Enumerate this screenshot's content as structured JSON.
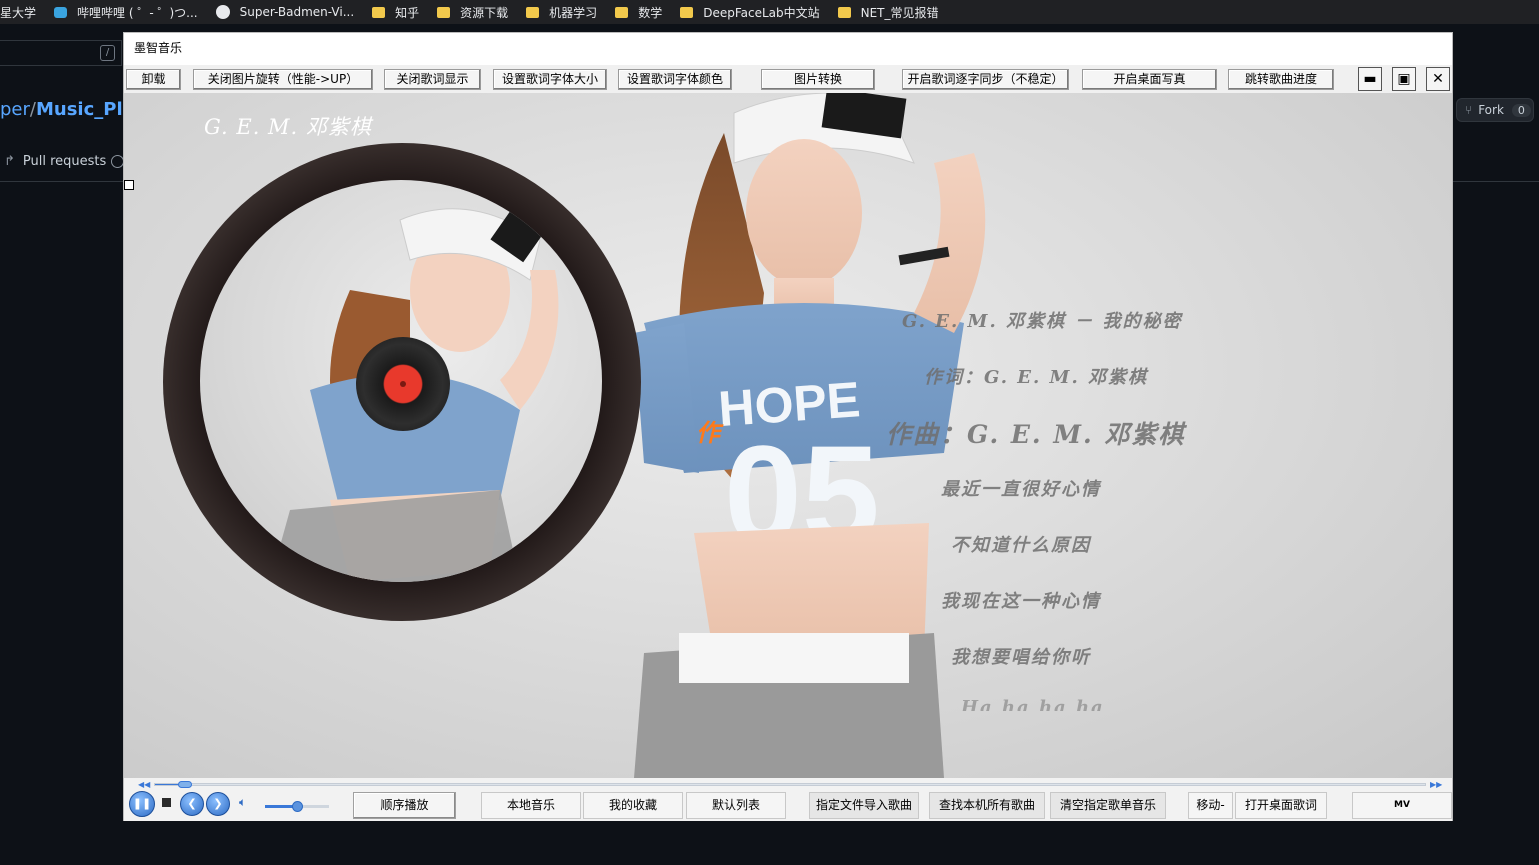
{
  "bookmarks": [
    {
      "label": "星大学",
      "icon": "none"
    },
    {
      "label": "哔哩哔哩 ( ゜- ゜)つ...",
      "icon": "bilibili-icon"
    },
    {
      "label": "Super-Badmen-Vi...",
      "icon": "github-icon"
    },
    {
      "label": "知乎",
      "icon": "folder-icon"
    },
    {
      "label": "资源下载",
      "icon": "folder-icon"
    },
    {
      "label": "机器学习",
      "icon": "folder-icon"
    },
    {
      "label": "数学",
      "icon": "folder-icon"
    },
    {
      "label": "DeepFaceLab中文站",
      "icon": "folder-icon"
    },
    {
      "label": "NET_常见报错",
      "icon": "folder-icon"
    }
  ],
  "github": {
    "search_slash": "/",
    "repo_owner": "per",
    "repo_sep": "/",
    "repo_name": "Music_Play",
    "pull_requests": "Pull requests",
    "fork_label": "Fork",
    "fork_count": "0"
  },
  "app": {
    "title": "墨智音乐",
    "toolbar": [
      "卸载",
      "关闭图片旋转（性能->UP）",
      "关闭歌词显示",
      "设置歌词字体大小",
      "设置歌词字体颜色",
      "图片转换",
      "开启歌词逐字同步（不稳定）",
      "开启桌面写真",
      "跳转歌曲进度"
    ],
    "window_buttons": {
      "minimize": "▬",
      "maximize": "▣",
      "close": "✕"
    },
    "singer": "G. E. M. 邓紫棋",
    "highlight_char": "作",
    "lyrics": [
      "G. E. M. 邓紫棋 － 我的秘密",
      "作词：G. E. M.  邓紫棋",
      "作曲：G. E. M.  邓紫棋",
      "最近一直很好心情",
      "不知道什么原因",
      "我现在这一种心情",
      "我想要唱给你听",
      "Ha ha ha ha"
    ],
    "progress_fraction": 0.02,
    "volume_fraction": 0.5,
    "controls": {
      "play_mode": "顺序播放",
      "local_music": "本地音乐",
      "favorites": "我的收藏",
      "default_list": "默认列表",
      "import_file": "指定文件导入歌曲",
      "scan_all": "查找本机所有歌曲",
      "clear_list": "清空指定歌单音乐",
      "move": "移动-",
      "desktop_lyrics": "打开桌面歌词",
      "mv": "MV"
    },
    "colors": {
      "accent_blue": "#3a78d8",
      "lyric_highlight": "#ff7a1a",
      "record_label": "#e8392c"
    }
  }
}
